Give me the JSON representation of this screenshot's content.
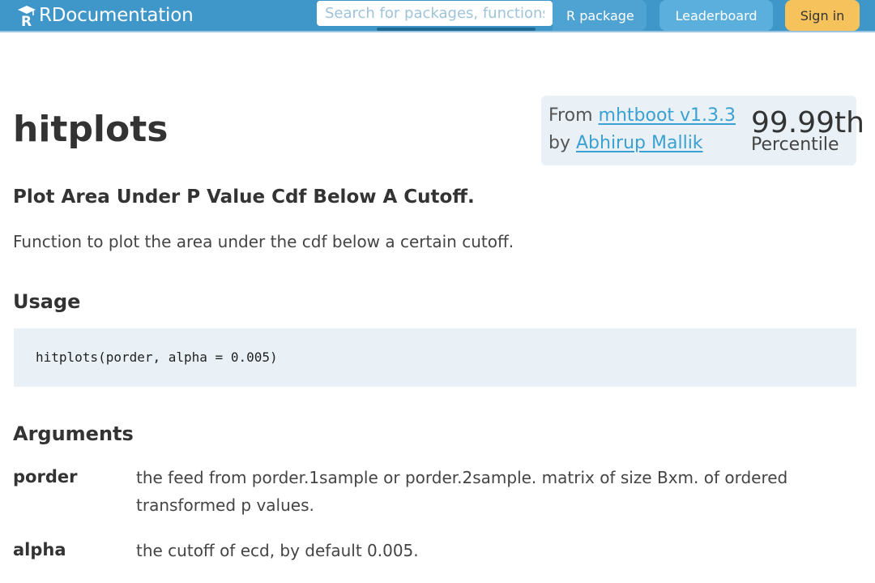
{
  "header": {
    "logo_text": "RDocumentation",
    "search_placeholder": "Search for packages, functions, etc",
    "nav": {
      "rpackage_label": "R package",
      "leaderboard_label": "Leaderboard",
      "signin_label": "Sign in"
    },
    "colors": {
      "header_bg": "#3f96c8",
      "signin_bg": "#f6c25b"
    }
  },
  "page": {
    "title": "hitplots",
    "info": {
      "from_prefix": "From",
      "package_link": "mhtboot v1.3.3",
      "by_prefix": "by",
      "author_link": "Abhirup Mallik",
      "percentile_value": "99.99th",
      "percentile_label": "Percentile"
    },
    "subtitle": "Plot Area Under P Value Cdf Below A Cutoff.",
    "description": "Function to plot the area under the cdf below a certain cutoff.",
    "usage": {
      "heading": "Usage",
      "code": "hitplots(porder, alpha = 0.005)"
    },
    "arguments": {
      "heading": "Arguments",
      "items": [
        {
          "name": "porder",
          "description": "the feed from porder.1sample or porder.2sample. matrix of size Bxm. of ordered transformed p values."
        },
        {
          "name": "alpha",
          "description": "the cutoff of ecd, by default 0.005."
        }
      ]
    }
  }
}
